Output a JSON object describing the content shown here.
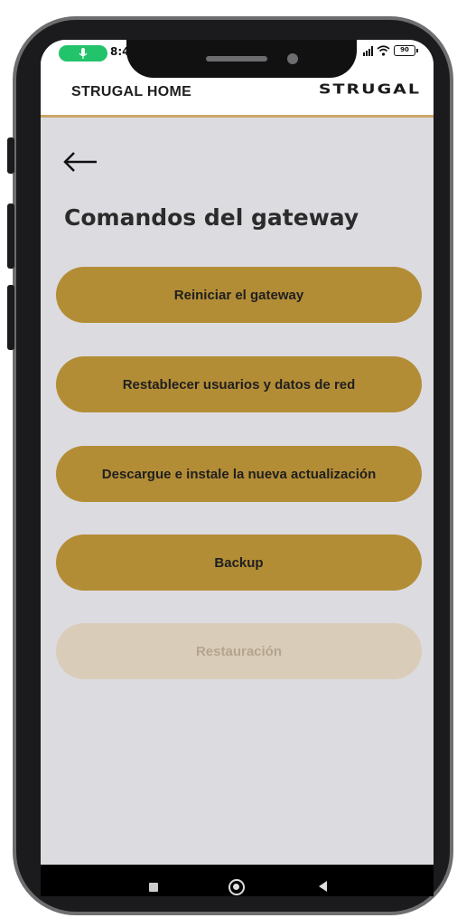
{
  "status_bar": {
    "time": "8:4",
    "battery": "90"
  },
  "app_bar": {
    "title": "STRUGAL HOME",
    "logo_text": "STRUGAL"
  },
  "page": {
    "title": "Comandos del gateway"
  },
  "commands": [
    {
      "label": "Reiniciar el gateway",
      "enabled": true
    },
    {
      "label": "Restablecer usuarios y datos de red",
      "enabled": true
    },
    {
      "label": "Descargue e instale la nueva actualización",
      "enabled": true
    },
    {
      "label": "Backup",
      "enabled": true
    },
    {
      "label": "Restauración",
      "enabled": false
    }
  ],
  "colors": {
    "accent": "#b38d36",
    "accent_disabled": "#d9ccb9",
    "background": "#dcdbe0",
    "divider": "#c9a769"
  },
  "icons": {
    "back": "arrow-left-icon",
    "mic": "mic-icon",
    "signal": "signal-icon",
    "wifi": "wifi-icon",
    "battery": "battery-icon"
  }
}
